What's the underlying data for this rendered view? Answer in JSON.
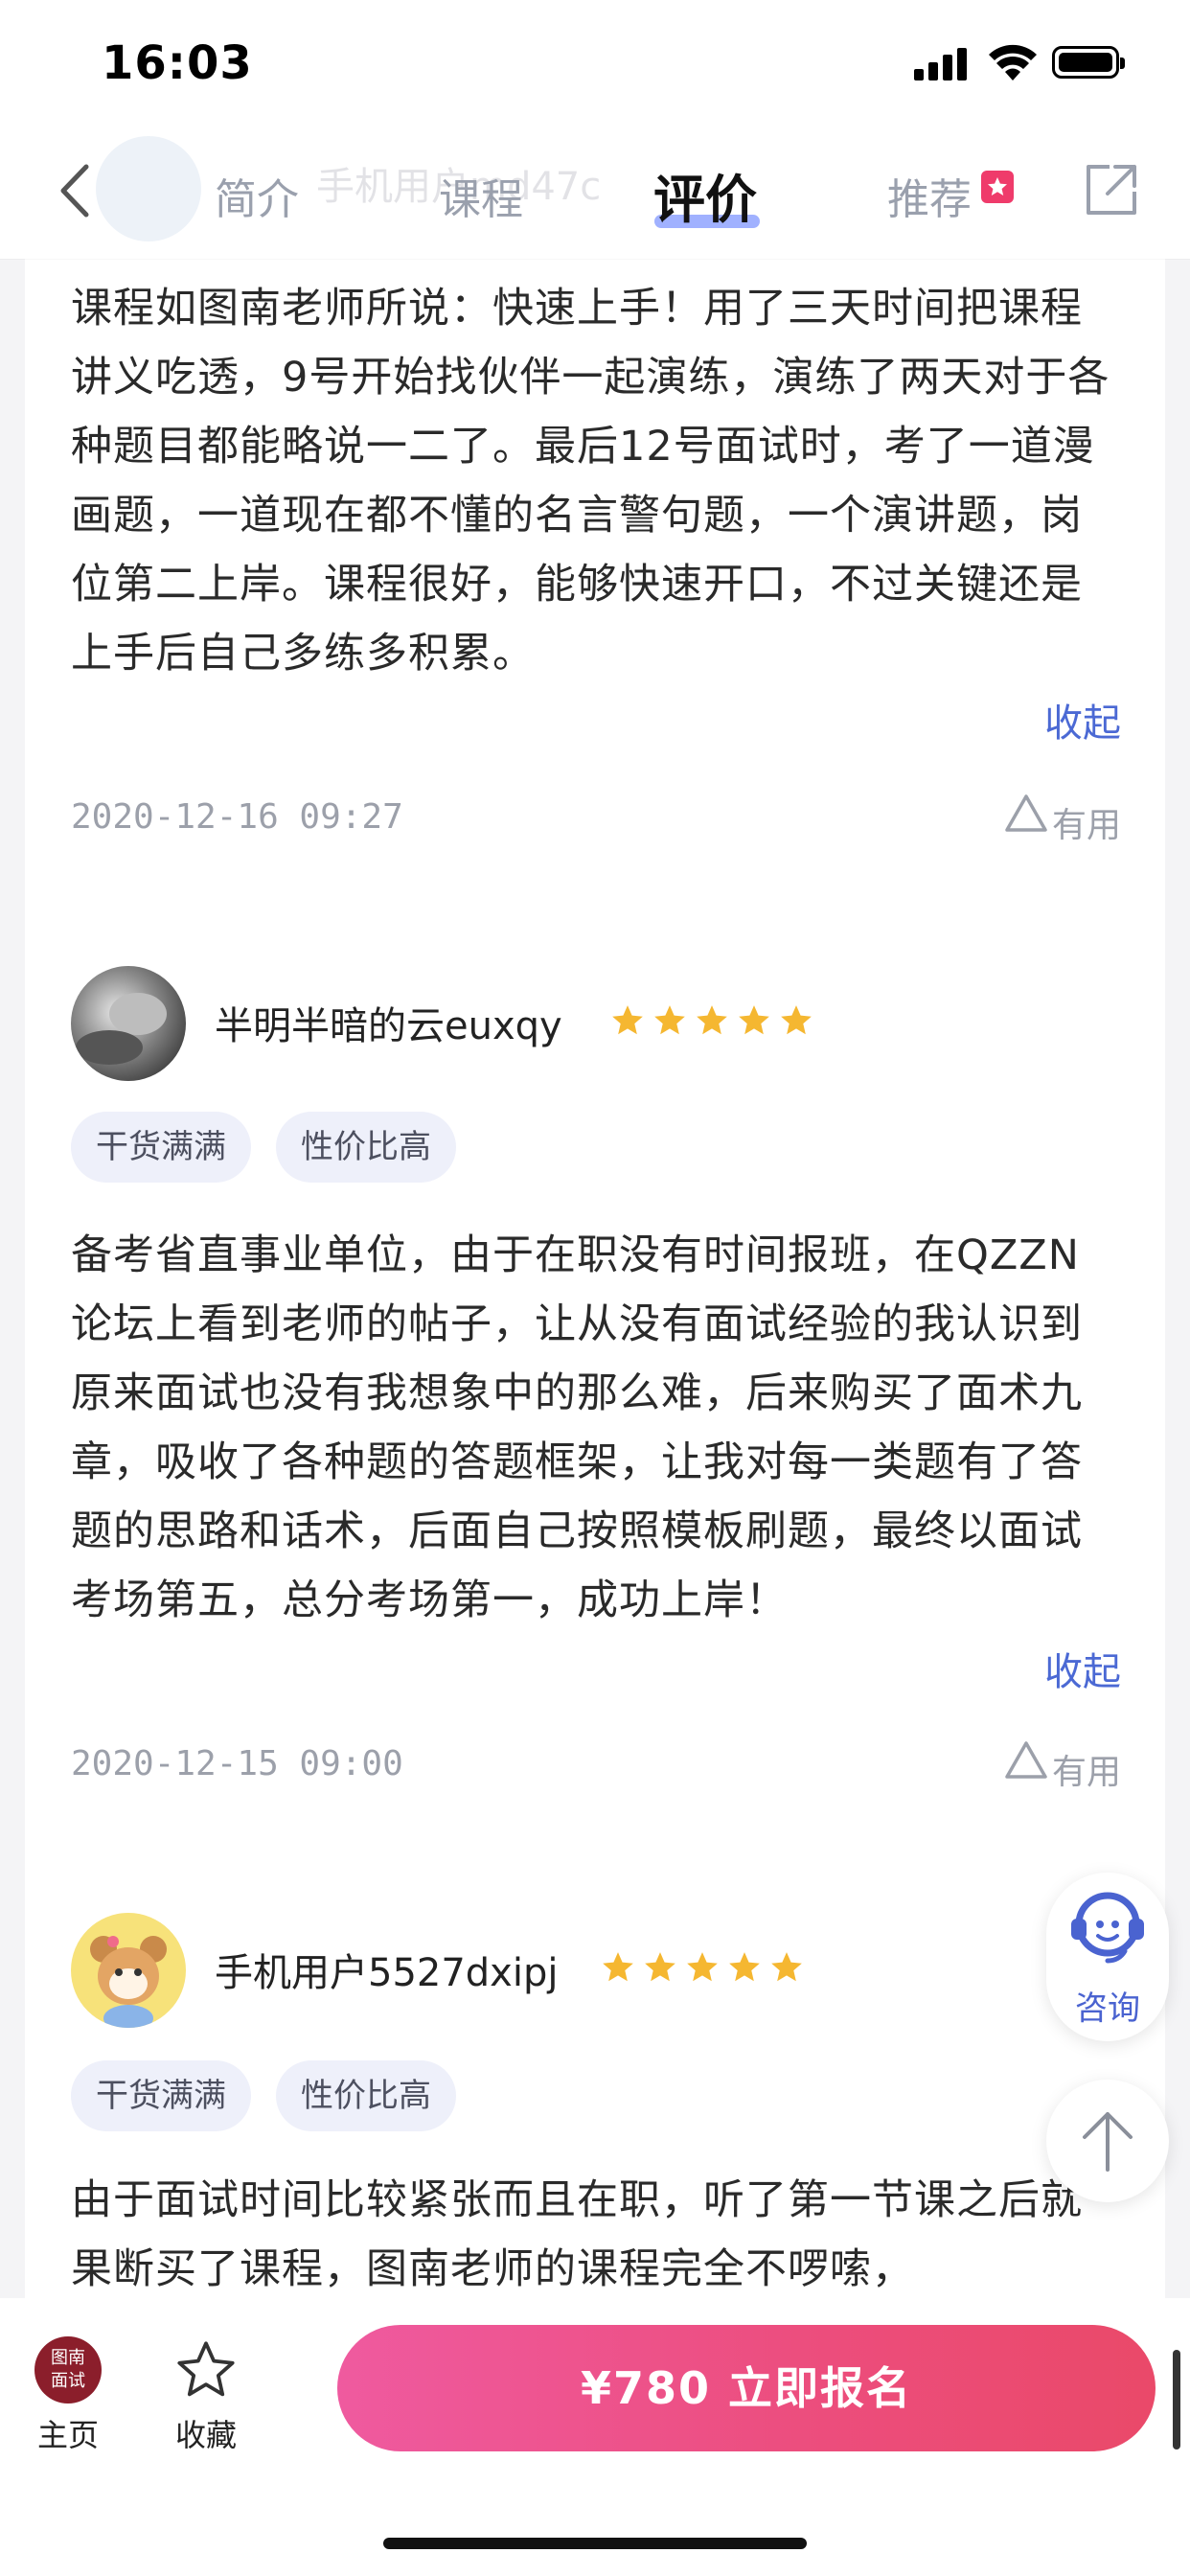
{
  "status": {
    "time": "16:03"
  },
  "nav": {
    "ghost_name": "手机用户md47c",
    "tabs": [
      "简介",
      "课程",
      "评价",
      "推荐"
    ],
    "active_tab": "评价"
  },
  "reviews": [
    {
      "text": "课程如图南老师所说：快速上手！用了三天时间把课程讲义吃透，9号开始找伙伴一起演练，演练了两天对于各种题目都能略说一二了。最后12号面试时，考了一道漫画题，一道现在都不懂的名言警句题，一个演讲题，岗位第二上岸。课程很好，能够快速开口，不过关键还是上手后自己多练多积累。",
      "collapse_label": "收起",
      "date": "2020-12-16 09:27",
      "useful_label": "有用"
    },
    {
      "username": "半明半暗的云euxqy",
      "rating": 5,
      "tags": [
        "干货满满",
        "性价比高"
      ],
      "text": "备考省直事业单位，由于在职没有时间报班，在QZZN论坛上看到老师的帖子，让从没有面试经验的我认识到原来面试也没有我想象中的那么难，后来购买了面术九章，吸收了各种题的答题框架，让我对每一类题有了答题的思路和话术，后面自己按照模板刷题，最终以面试考场第五，总分考场第一，成功上岸！",
      "collapse_label": "收起",
      "date": "2020-12-15 09:00",
      "useful_label": "有用"
    },
    {
      "username": "手机用户5527dxipj",
      "rating": 5,
      "tags": [
        "干货满满",
        "性价比高"
      ],
      "text": "由于面试时间比较紧张而且在职，听了第一节课之后就果断买了课程，图南老师的课程完全不啰嗦，"
    }
  ],
  "floating": {
    "consult_label": "咨询"
  },
  "bottom_bar": {
    "logo_text": [
      "图南",
      "面试"
    ],
    "home_label": "主页",
    "favorite_label": "收藏",
    "enroll_label": "¥780  立即报名"
  },
  "colors": {
    "accent": "#4b69d4",
    "star": "#f5b731",
    "cta": "#ec4d7c"
  }
}
